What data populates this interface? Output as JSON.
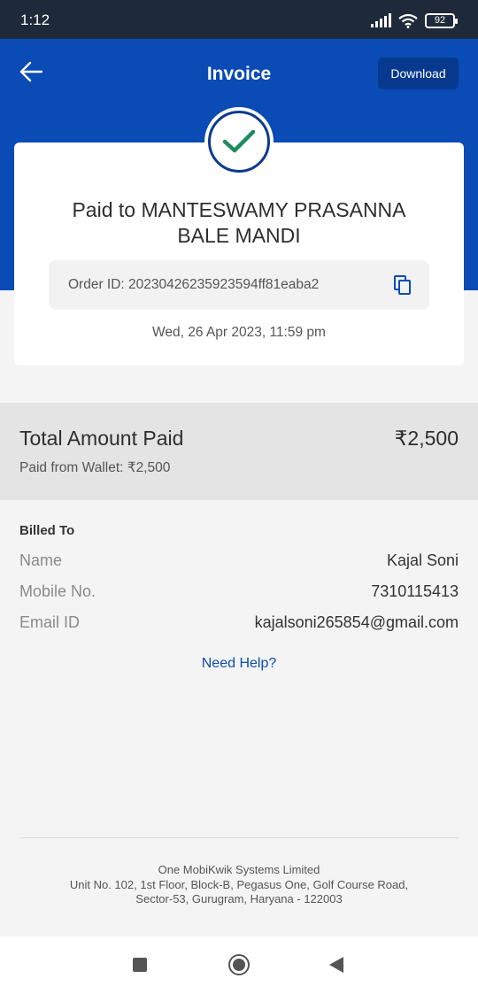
{
  "status_bar": {
    "time": "1:12",
    "battery": "92"
  },
  "header": {
    "title": "Invoice",
    "download_label": "Download"
  },
  "payment": {
    "paid_to": "Paid to MANTESWAMY PRASANNA BALE MANDI",
    "order_id": "Order ID: 20230426235923594ff81eaba2",
    "datetime": "Wed, 26 Apr 2023, 11:59 pm"
  },
  "total": {
    "label": "Total Amount Paid",
    "amount": "₹2,500",
    "wallet_text": "Paid from Wallet: ₹2,500"
  },
  "billed": {
    "title": "Billed To",
    "rows": [
      {
        "label": "Name",
        "value": "Kajal Soni"
      },
      {
        "label": "Mobile No.",
        "value": "7310115413"
      },
      {
        "label": "Email ID",
        "value": "kajalsoni265854@gmail.com"
      }
    ]
  },
  "help_label": "Need Help?",
  "footer": {
    "company": "One MobiKwik Systems Limited",
    "address_line1": "Unit No. 102, 1st Floor, Block-B, Pegasus One, Golf Course Road,",
    "address_line2": "Sector-53, Gurugram, Haryana - 122003"
  },
  "colors": {
    "brand_blue": "#0a4bb5",
    "check_green": "#1f8a5b",
    "link_blue": "#0a4bb5"
  }
}
